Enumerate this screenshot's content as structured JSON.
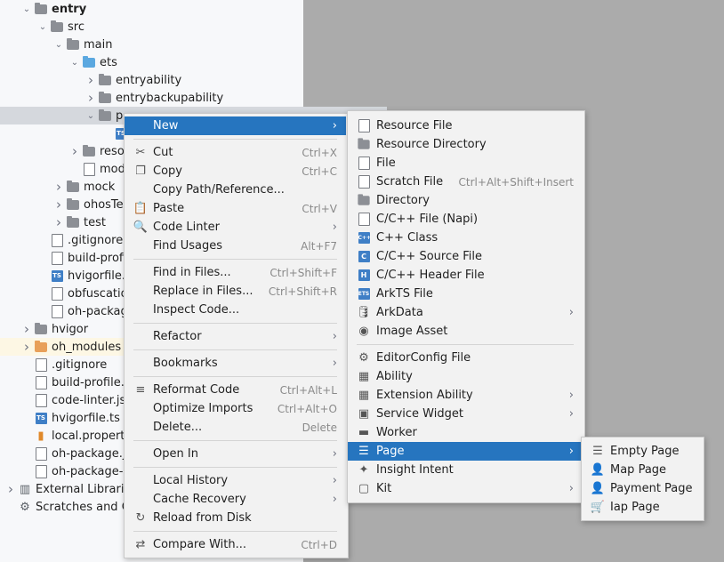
{
  "tree": [
    {
      "label": "entry",
      "indent": 1,
      "expanded": true,
      "icon": "folder",
      "bold": true
    },
    {
      "label": "src",
      "indent": 2,
      "expanded": true,
      "icon": "folder"
    },
    {
      "label": "main",
      "indent": 3,
      "expanded": true,
      "icon": "folder"
    },
    {
      "label": "ets",
      "indent": 4,
      "expanded": true,
      "icon": "folder-blue"
    },
    {
      "label": "entryability",
      "indent": 5,
      "expanded": false,
      "icon": "folder"
    },
    {
      "label": "entrybackupability",
      "indent": 5,
      "expanded": false,
      "icon": "folder"
    },
    {
      "label": "p",
      "indent": 5,
      "expanded": true,
      "icon": "folder",
      "selected": true
    },
    {
      "label": "",
      "indent": 6,
      "icon": "ts-file"
    },
    {
      "label": "reso",
      "indent": 4,
      "expanded": false,
      "icon": "folder"
    },
    {
      "label": "mod",
      "indent": 4,
      "icon": "file"
    },
    {
      "label": "mock",
      "indent": 3,
      "expanded": false,
      "icon": "folder"
    },
    {
      "label": "ohosTe",
      "indent": 3,
      "expanded": false,
      "icon": "folder"
    },
    {
      "label": "test",
      "indent": 3,
      "expanded": false,
      "icon": "folder"
    },
    {
      "label": ".gitignore",
      "indent": 2,
      "icon": "file"
    },
    {
      "label": "build-profi",
      "indent": 2,
      "icon": "file"
    },
    {
      "label": "hvigorfile.ts",
      "indent": 2,
      "icon": "ts-file"
    },
    {
      "label": "obfuscation",
      "indent": 2,
      "icon": "file"
    },
    {
      "label": "oh-packag",
      "indent": 2,
      "icon": "file"
    },
    {
      "label": "hvigor",
      "indent": 1,
      "expanded": false,
      "icon": "folder"
    },
    {
      "label": "oh_modules",
      "indent": 1,
      "expanded": false,
      "icon": "folder-orange",
      "highlight": true
    },
    {
      "label": ".gitignore",
      "indent": 1,
      "icon": "file"
    },
    {
      "label": "build-profile.js",
      "indent": 1,
      "icon": "file"
    },
    {
      "label": "code-linter.jsc",
      "indent": 1,
      "icon": "file"
    },
    {
      "label": "hvigorfile.ts",
      "indent": 1,
      "icon": "ts-file"
    },
    {
      "label": "local.properti",
      "indent": 1,
      "icon": "chart-file"
    },
    {
      "label": "oh-package.js",
      "indent": 1,
      "icon": "file"
    },
    {
      "label": "oh-package-lo",
      "indent": 1,
      "icon": "file"
    },
    {
      "label": "External Libraries",
      "indent": 0,
      "expanded": false,
      "icon": "library"
    },
    {
      "label": "Scratches and Co",
      "indent": 0,
      "icon": "scratches"
    }
  ],
  "context_menu": {
    "items": [
      {
        "label": "New",
        "icon": "",
        "shortcut": "",
        "submenu": true,
        "active": true
      },
      {
        "sep": true
      },
      {
        "label": "Cut",
        "icon": "✂",
        "shortcut": "Ctrl+X"
      },
      {
        "label": "Copy",
        "icon": "❐",
        "shortcut": "Ctrl+C"
      },
      {
        "label": "Copy Path/Reference...",
        "icon": "",
        "shortcut": ""
      },
      {
        "label": "Paste",
        "icon": "📋",
        "shortcut": "Ctrl+V"
      },
      {
        "label": "Code Linter",
        "icon": "🔍",
        "shortcut": "",
        "submenu": true
      },
      {
        "label": "Find Usages",
        "icon": "",
        "shortcut": "Alt+F7"
      },
      {
        "sep": true
      },
      {
        "label": "Find in Files...",
        "icon": "",
        "shortcut": "Ctrl+Shift+F"
      },
      {
        "label": "Replace in Files...",
        "icon": "",
        "shortcut": "Ctrl+Shift+R"
      },
      {
        "label": "Inspect Code...",
        "icon": "",
        "shortcut": ""
      },
      {
        "sep": true
      },
      {
        "label": "Refactor",
        "icon": "",
        "shortcut": "",
        "submenu": true
      },
      {
        "sep": true
      },
      {
        "label": "Bookmarks",
        "icon": "",
        "shortcut": "",
        "submenu": true
      },
      {
        "sep": true
      },
      {
        "label": "Reformat Code",
        "icon": "≡",
        "shortcut": "Ctrl+Alt+L"
      },
      {
        "label": "Optimize Imports",
        "icon": "",
        "shortcut": "Ctrl+Alt+O"
      },
      {
        "label": "Delete...",
        "icon": "",
        "shortcut": "Delete"
      },
      {
        "sep": true
      },
      {
        "label": "Open In",
        "icon": "",
        "shortcut": "",
        "submenu": true
      },
      {
        "sep": true
      },
      {
        "label": "Local History",
        "icon": "",
        "shortcut": "",
        "submenu": true
      },
      {
        "label": "Cache Recovery",
        "icon": "",
        "shortcut": "",
        "submenu": true
      },
      {
        "label": "Reload from Disk",
        "icon": "↻",
        "shortcut": ""
      },
      {
        "sep": true
      },
      {
        "label": "Compare With...",
        "icon": "⇄",
        "shortcut": "Ctrl+D"
      }
    ]
  },
  "new_menu": {
    "items": [
      {
        "label": "Resource File",
        "icon": "file",
        "shortcut": ""
      },
      {
        "label": "Resource Directory",
        "icon": "folder",
        "shortcut": ""
      },
      {
        "label": "File",
        "icon": "file",
        "shortcut": ""
      },
      {
        "label": "Scratch File",
        "icon": "file",
        "shortcut": "Ctrl+Alt+Shift+Insert"
      },
      {
        "label": "Directory",
        "icon": "folder",
        "shortcut": ""
      },
      {
        "label": "C/C++ File (Napi)",
        "icon": "file",
        "shortcut": ""
      },
      {
        "label": "C++ Class",
        "icon": "C++",
        "shortcut": ""
      },
      {
        "label": "C/C++ Source File",
        "icon": "C",
        "shortcut": ""
      },
      {
        "label": "C/C++ Header File",
        "icon": "H",
        "shortcut": ""
      },
      {
        "label": "ArkTS File",
        "icon": "ETS",
        "shortcut": ""
      },
      {
        "label": "ArkData",
        "icon": "db",
        "shortcut": "",
        "submenu": true
      },
      {
        "label": "Image Asset",
        "icon": "img",
        "shortcut": ""
      },
      {
        "sep": true
      },
      {
        "label": "EditorConfig File",
        "icon": "gear",
        "shortcut": ""
      },
      {
        "label": "Ability",
        "icon": "grid",
        "shortcut": ""
      },
      {
        "label": "Extension Ability",
        "icon": "grid",
        "shortcut": "",
        "submenu": true
      },
      {
        "label": "Service Widget",
        "icon": "widget",
        "shortcut": "",
        "submenu": true
      },
      {
        "label": "Worker",
        "icon": "worker",
        "shortcut": ""
      },
      {
        "label": "Page",
        "icon": "list",
        "shortcut": "",
        "submenu": true,
        "active": true
      },
      {
        "label": "Insight Intent",
        "icon": "intent",
        "shortcut": ""
      },
      {
        "label": "Kit",
        "icon": "kit",
        "shortcut": "",
        "submenu": true
      }
    ]
  },
  "page_menu": {
    "items": [
      {
        "label": "Empty Page",
        "icon": "list"
      },
      {
        "label": "Map Page",
        "icon": "person"
      },
      {
        "label": "Payment Page",
        "icon": "person"
      },
      {
        "label": "Iap Page",
        "icon": "cart"
      }
    ]
  }
}
